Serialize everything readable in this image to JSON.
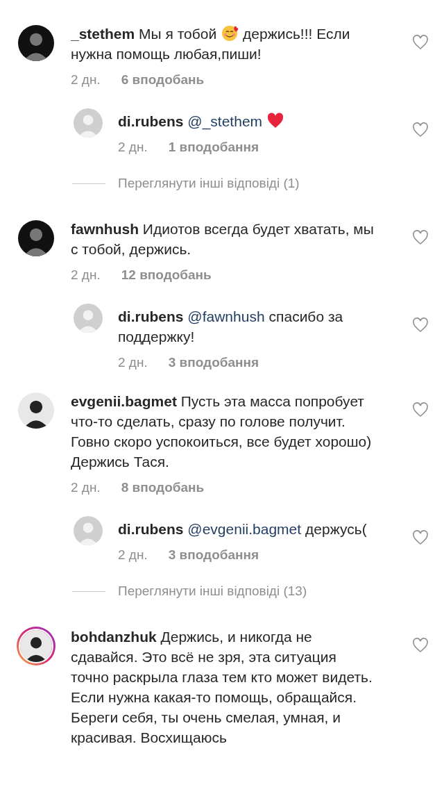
{
  "threads": [
    {
      "comment": {
        "user": "_stethem",
        "story": false,
        "liked": false,
        "parts": [
          {
            "kind": "text",
            "text": "Мы я тобой"
          },
          {
            "kind": "smile_emoji"
          },
          {
            "kind": "text",
            "text": "держись!!! Если нужна помощь любая,пиши!"
          }
        ],
        "time": "2 дн.",
        "likes": "6 вподобань"
      },
      "replies": [
        {
          "user": "di.rubens",
          "story": false,
          "liked": false,
          "parts": [
            {
              "kind": "mention",
              "text": "@_stethem"
            },
            {
              "kind": "heart_emoji"
            }
          ],
          "time": "2 дн.",
          "likes": "1 вподобання"
        }
      ],
      "more": "Переглянути інші відповіді (1)"
    },
    {
      "comment": {
        "user": "fawnhush",
        "story": false,
        "liked": false,
        "parts": [
          {
            "kind": "text",
            "text": "Идиотов всегда будет хватать, мы с тобой, держись."
          }
        ],
        "time": "2 дн.",
        "likes": "12 вподобань"
      },
      "replies": [
        {
          "user": "di.rubens",
          "story": false,
          "liked": false,
          "parts": [
            {
              "kind": "mention",
              "text": "@fawnhush"
            },
            {
              "kind": "text",
              "text": "спасибо за поддержку!"
            }
          ],
          "time": "2 дн.",
          "likes": "3 вподобання"
        }
      ]
    },
    {
      "comment": {
        "user": "evgenii.bagmet",
        "story": false,
        "liked": false,
        "parts": [
          {
            "kind": "text",
            "text": "Пусть эта масса попробует что-то сделать, сразу по голове получит. Говно скоро успокоиться, все будет хорошо) Держись Тася."
          }
        ],
        "time": "2 дн.",
        "likes": "8 вподобань"
      },
      "replies": [
        {
          "user": "di.rubens",
          "story": false,
          "liked": false,
          "parts": [
            {
              "kind": "mention",
              "text": "@evgenii.bagmet"
            },
            {
              "kind": "text",
              "text": "держусь("
            }
          ],
          "time": "2 дн.",
          "likes": "3 вподобання"
        }
      ],
      "more": "Переглянути інші відповіді (13)"
    },
    {
      "comment": {
        "user": "bohdanzhuk",
        "story": true,
        "liked": false,
        "parts": [
          {
            "kind": "text",
            "text": "Держись, и никогда не сдавайся. Это всё не зря, эта ситуация точно раскрыла глаза тем кто может видеть. Если нужна какая-то помощь, обращайся. Береги себя, ты очень смелая, умная, и красивая. Восхищаюсь"
          }
        ]
      }
    }
  ]
}
